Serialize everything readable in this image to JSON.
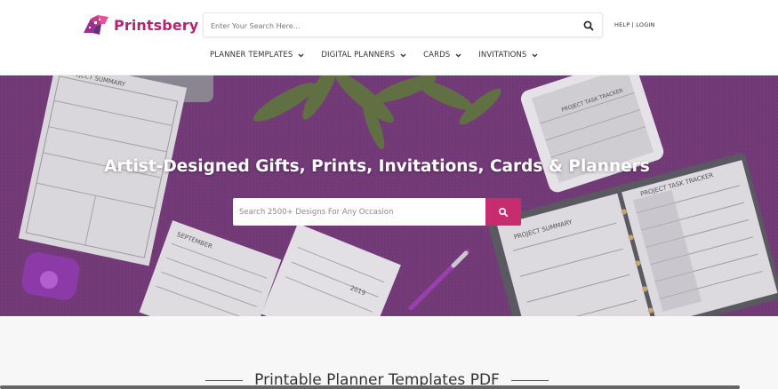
{
  "brand": {
    "name": "Printsbery",
    "accent_color": "#b5246e",
    "logo_icon": "printsbery-logo-mark"
  },
  "header": {
    "search": {
      "placeholder": "Enter Your Search Here...",
      "icon": "search-icon"
    },
    "help": "HELP",
    "separator": "|",
    "login": "LOGIN"
  },
  "nav": {
    "items": [
      {
        "label": "PLANNER TEMPLATES",
        "icon": "chevron-down-icon"
      },
      {
        "label": "DIGITAL PLANNERS",
        "icon": "chevron-down-icon"
      },
      {
        "label": "CARDS",
        "icon": "chevron-down-icon"
      },
      {
        "label": "INVITATIONS",
        "icon": "chevron-down-icon"
      }
    ]
  },
  "hero": {
    "title": "Artist-Designed Gifts, Prints, Invitations, Cards & Planners",
    "search_placeholder": "Search 2500+ Designs For Any Occasion",
    "search_button_color": "#c72d6e",
    "background_color": "#713a76",
    "image_text": {
      "project_summary": "PROJECT SUMMARY",
      "project_task_tracker": "PROJECT TASK TRACKER",
      "september": "SEPTEMBER",
      "year": "2019"
    }
  },
  "section": {
    "heading": "Printable Planner Templates PDF"
  }
}
